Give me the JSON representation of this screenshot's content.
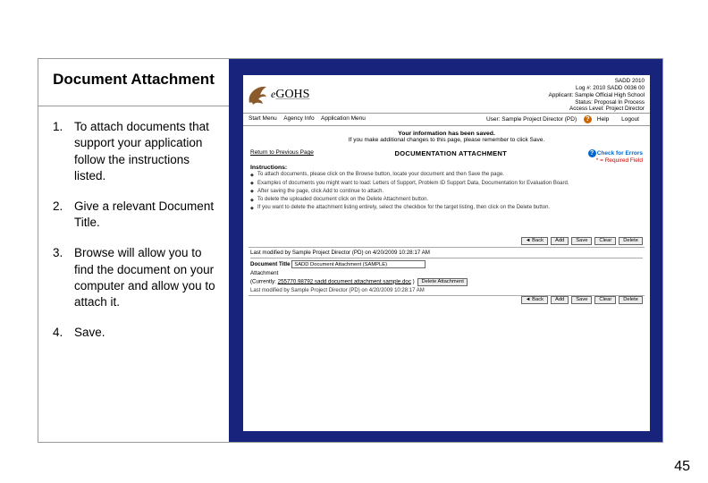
{
  "title": "Document Attachment",
  "steps": {
    "s1": "To attach documents that support your application follow the instructions listed.",
    "s2": "Give a relevant Document Title.",
    "s3": "Browse will allow you to find the document on your computer and allow you to attach it.",
    "s4": "Save."
  },
  "panel": {
    "brand_e": "e",
    "brand_rest": "GOHS",
    "meta": {
      "m1": "SADD 2010",
      "m2": "Log #: 2010 SADD 0036 00",
      "m3": "Applicant: Sample Official High School",
      "m4": "Status: Proposal In Process",
      "m5": "Access Level: Project Director"
    },
    "nav": {
      "start": "Start Menu",
      "agency": "Agency Info",
      "app": "Application Menu",
      "user": "User: Sample Project Director (PD)",
      "help": "Help",
      "logout": "Logout"
    },
    "saved": {
      "bold": "Your information has been saved.",
      "sub": "If you make additional changes to this page, please remember to click Save."
    },
    "row": {
      "return": "Return to Previous Page",
      "title": "DOCUMENTATION ATTACHMENT",
      "check": "Check for Errors",
      "required": "* = Required Field"
    },
    "instructions": {
      "header": "Instructions:",
      "i1": "To attach documents, please click on the Browse button, locate your document and then Save the page.",
      "i2": "Examples of documents you might want to load: Letters of Support, Problem ID Support Data, Documentation for Evaluation Board.",
      "i3": "After saving the page, click Add to continue to attach.",
      "i4": "To delete the uploaded document click on the Delete Attachment button.",
      "i5": "If you want to delete the attachment listing entirely, select the checkbox for the target listing, then click on the Delete button."
    },
    "buttons": {
      "back": "◄ Back",
      "add": "Add",
      "save": "Save",
      "clear": "Clear",
      "delete": "Delete",
      "delattach": "Delete Attachment"
    },
    "form": {
      "modline": "Last modified by Sample Project Director (PD) on 4/20/2009 10:28:17 AM",
      "doc_title_label": "Document Title",
      "doc_title_val": "SADD Document Attachment (SAMPLE)",
      "attach_label": "Attachment",
      "currently": "(Currently:",
      "file": "255770.98792 sadd document attachment sample.doc",
      "close": ")",
      "lastmod2": "Last modified by Sample Project Director (PD) on 4/20/2009 10:28:17 AM"
    }
  },
  "page_number": "45"
}
